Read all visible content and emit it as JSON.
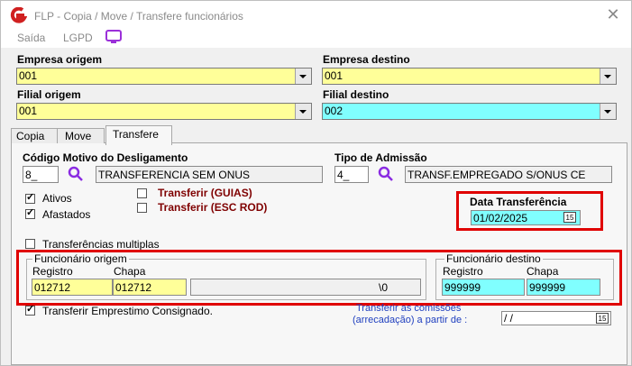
{
  "window": {
    "title": "FLP - Copia / Move / Transfere funcionários",
    "close": "✕"
  },
  "menu": {
    "items": [
      "Saída",
      "LGPD"
    ]
  },
  "header": {
    "empresa_origem_label": "Empresa origem",
    "empresa_origem_value": "001",
    "empresa_destino_label": "Empresa destino",
    "empresa_destino_value": "001",
    "filial_origem_label": "Filial origem",
    "filial_origem_value": "001",
    "filial_destino_label": "Filial destino",
    "filial_destino_value": "002"
  },
  "tabs": [
    {
      "label": "Copia"
    },
    {
      "label": "Move"
    },
    {
      "label": "Transfere"
    }
  ],
  "form": {
    "codigo_label": "Código Motivo do Desligamento",
    "codigo_value": "8_",
    "codigo_desc": "TRANSFERENCIA SEM ONUS",
    "tipo_label": "Tipo de Admissão",
    "tipo_value": "4_",
    "tipo_desc": "TRANSF.EMPREGADO S/ONUS CE",
    "ativos": "Ativos",
    "afastados": "Afastados",
    "transferir_guias": "Transferir (GUIAS)",
    "transferir_esc": "Transferir (ESC ROD)",
    "data_label": "Data Transferência",
    "data_value": "01/02/2025",
    "multiplas": "Transferências multiplas",
    "func_origem_title": "Funcionário origem",
    "registro_label": "Registro",
    "chapa_label": "Chapa",
    "origem_registro": "012712",
    "origem_chapa": "012712",
    "origem_extra": "\\0",
    "func_destino_title": "Funcionário destino",
    "destino_registro": "999999",
    "destino_chapa": "999999",
    "emprestimo": "Transferir Emprestimo Consignado.",
    "comissoes_line1": "Transferir as comissões",
    "comissoes_line2": "(arrecadação)  a partir de :",
    "comissoes_value": " /  /",
    "cal_icon": "calendar-icon",
    "search_icon": "search-icon"
  },
  "colors": {
    "yellow_field": "#ffff99",
    "cyan_field": "#80ffff",
    "highlight": "#e00000",
    "dark_red_text": "#7f0000",
    "link_blue": "#1f3fbf"
  }
}
